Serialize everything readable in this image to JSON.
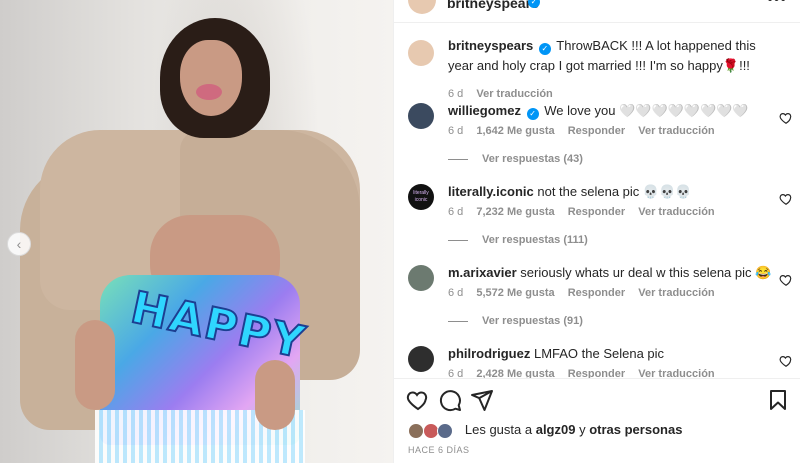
{
  "post": {
    "author": "britneyspears",
    "caption_author": "britneyspears",
    "caption_text": "ThrowBACK !!! A lot happened this year and holy crap I got married !!! I'm so happy🌹!!!",
    "caption_time": "6 d",
    "caption_translate": "Ver traducción",
    "more_icon": "more-horizontal-icon",
    "prev_icon": "chevron-left-icon",
    "photo_print_text": "HAPPY"
  },
  "comments": [
    {
      "user": "williegomez",
      "verified": true,
      "text": "We love you 🤍🤍🤍🤍🤍🤍🤍🤍",
      "time": "6 d",
      "likes": "1,642 Me gusta",
      "reply": "Responder",
      "translate": "Ver traducción",
      "replies": "Ver respuestas (43)",
      "avatar_color": "#3b4a5f"
    },
    {
      "user": "literally.iconic",
      "verified": false,
      "text": "not the selena pic 💀💀💀",
      "time": "6 d",
      "likes": "7,232 Me gusta",
      "reply": "Responder",
      "translate": "Ver traducción",
      "replies": "Ver respuestas (111)",
      "avatar_color": "#111111",
      "avatar_text": "literally iconic"
    },
    {
      "user": "m.arixavier",
      "verified": false,
      "text": "seriously whats ur deal w this selena pic 😂",
      "time": "6 d",
      "likes": "5,572 Me gusta",
      "reply": "Responder",
      "translate": "Ver traducción",
      "replies": "Ver respuestas (91)",
      "avatar_color": "#6c7a70"
    },
    {
      "user": "philrodriguez",
      "verified": false,
      "text": "LMFAO the Selena pic",
      "time": "6 d",
      "likes": "2,428 Me gusta",
      "reply": "Responder",
      "translate": "Ver traducción",
      "avatar_color": "#2e2e2e"
    }
  ],
  "actions": {
    "like_icon": "heart-icon",
    "comment_icon": "comment-icon",
    "share_icon": "send-icon",
    "save_icon": "bookmark-icon"
  },
  "likes": {
    "prefix": "Les gusta a",
    "user": "algz09",
    "conj": "y",
    "others": "otras personas"
  },
  "date": "HACE 6 DÍAS",
  "colors": {
    "verified_blue": "#0095f6",
    "text": "#262626",
    "muted": "#8e8e8e",
    "border": "#efefef"
  }
}
